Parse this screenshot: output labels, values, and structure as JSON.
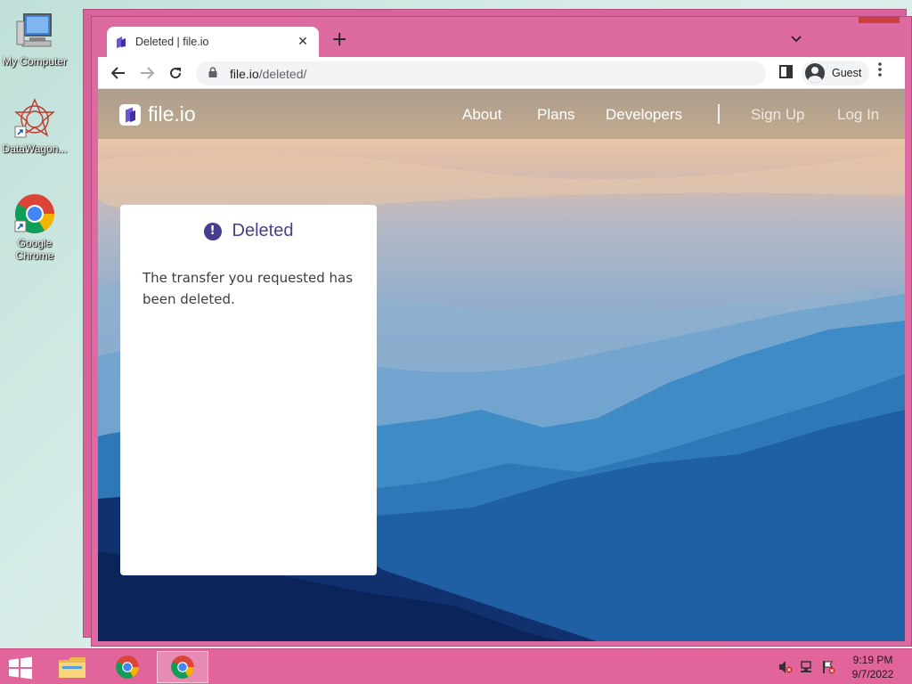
{
  "desktop": {
    "icons": [
      {
        "label": "My Computer",
        "icon": "computer-icon"
      },
      {
        "label": "DataWagon...",
        "icon": "datawagon-icon"
      },
      {
        "label": "Google Chrome",
        "icon": "chrome-icon"
      }
    ]
  },
  "browser": {
    "tab": {
      "title": "Deleted | file.io",
      "close": "✕"
    },
    "new_tab": "+",
    "tab_menu": "⌄",
    "address": {
      "host": "file.io",
      "path": "/deleted/"
    },
    "profile_label": "Guest"
  },
  "site": {
    "logo_text": "file.io",
    "nav": {
      "about": "About",
      "plans": "Plans",
      "developers": "Developers",
      "sign_up": "Sign Up",
      "log_in": "Log In"
    },
    "card": {
      "title": "Deleted",
      "icon_glyph": "!",
      "message": "The transfer you requested has been deleted."
    }
  },
  "taskbar": {
    "time": "9:19 PM",
    "date": "9/7/2022"
  },
  "colors": {
    "window_frame": "#de6aa2",
    "card_accent": "#453e8f",
    "taskbar": "#e1649a"
  }
}
